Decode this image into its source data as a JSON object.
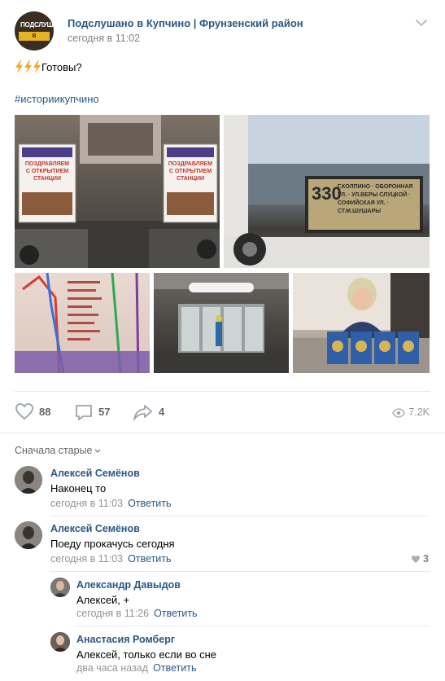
{
  "group": {
    "name": "Подслушано в Купчино | Фрунзенский район",
    "avatar_top": "ПОДСЛУШАНО",
    "avatar_badge": "В КУПЧИНО",
    "date": "сегодня в 11:02"
  },
  "post": {
    "text": "Готовы?",
    "bolt_count": 3,
    "hashtag": "#историикупчино",
    "photo_text": {
      "banner_left": "ПОЗДРАВЛЯЕМ С ОТКРЫТИЕМ СТАНЦИИ",
      "banner_right": "ПОЗДРАВЛЯЕМ С ОТКРЫТИЕМ СТАНЦИИ",
      "bus_route": "330",
      "bus_sign": "Г.КОЛПИНО · ОБОРОННАЯ УЛ. · УЛ.ВЕРЫ СЛУЦКОЙ · СОФИЙСКАЯ УЛ. · СТ.М.ШУШАРЫ"
    }
  },
  "actions": {
    "likes": "88",
    "comments": "57",
    "shares": "4",
    "views": "7.2K"
  },
  "comments_sort": "Сначала старые",
  "comments": [
    {
      "author": "Алексей Семёнов",
      "text": "Наконец то",
      "date": "сегодня в 11:03",
      "reply": "Ответить"
    },
    {
      "author": "Алексей Семёнов",
      "text": "Поеду прокачусь сегодня",
      "date": "сегодня в 11:03",
      "reply": "Ответить",
      "likes": "3"
    },
    {
      "author": "Александр Давыдов",
      "text": "Алексей, +",
      "date": "сегодня в 11:26",
      "reply": "Ответить"
    },
    {
      "author": "Анастасия Ромберг",
      "text": "Алексей, только если во сне",
      "date": "два часа назад",
      "reply": "Ответить"
    }
  ],
  "colors": {
    "link": "#2a5885",
    "secondary": "#828282",
    "divider": "#e7e8ec",
    "action_gray": "#656565"
  },
  "icons": [
    "bolt-icon",
    "chevron-down-icon",
    "heart-icon",
    "comment-icon",
    "share-icon",
    "eye-icon"
  ]
}
